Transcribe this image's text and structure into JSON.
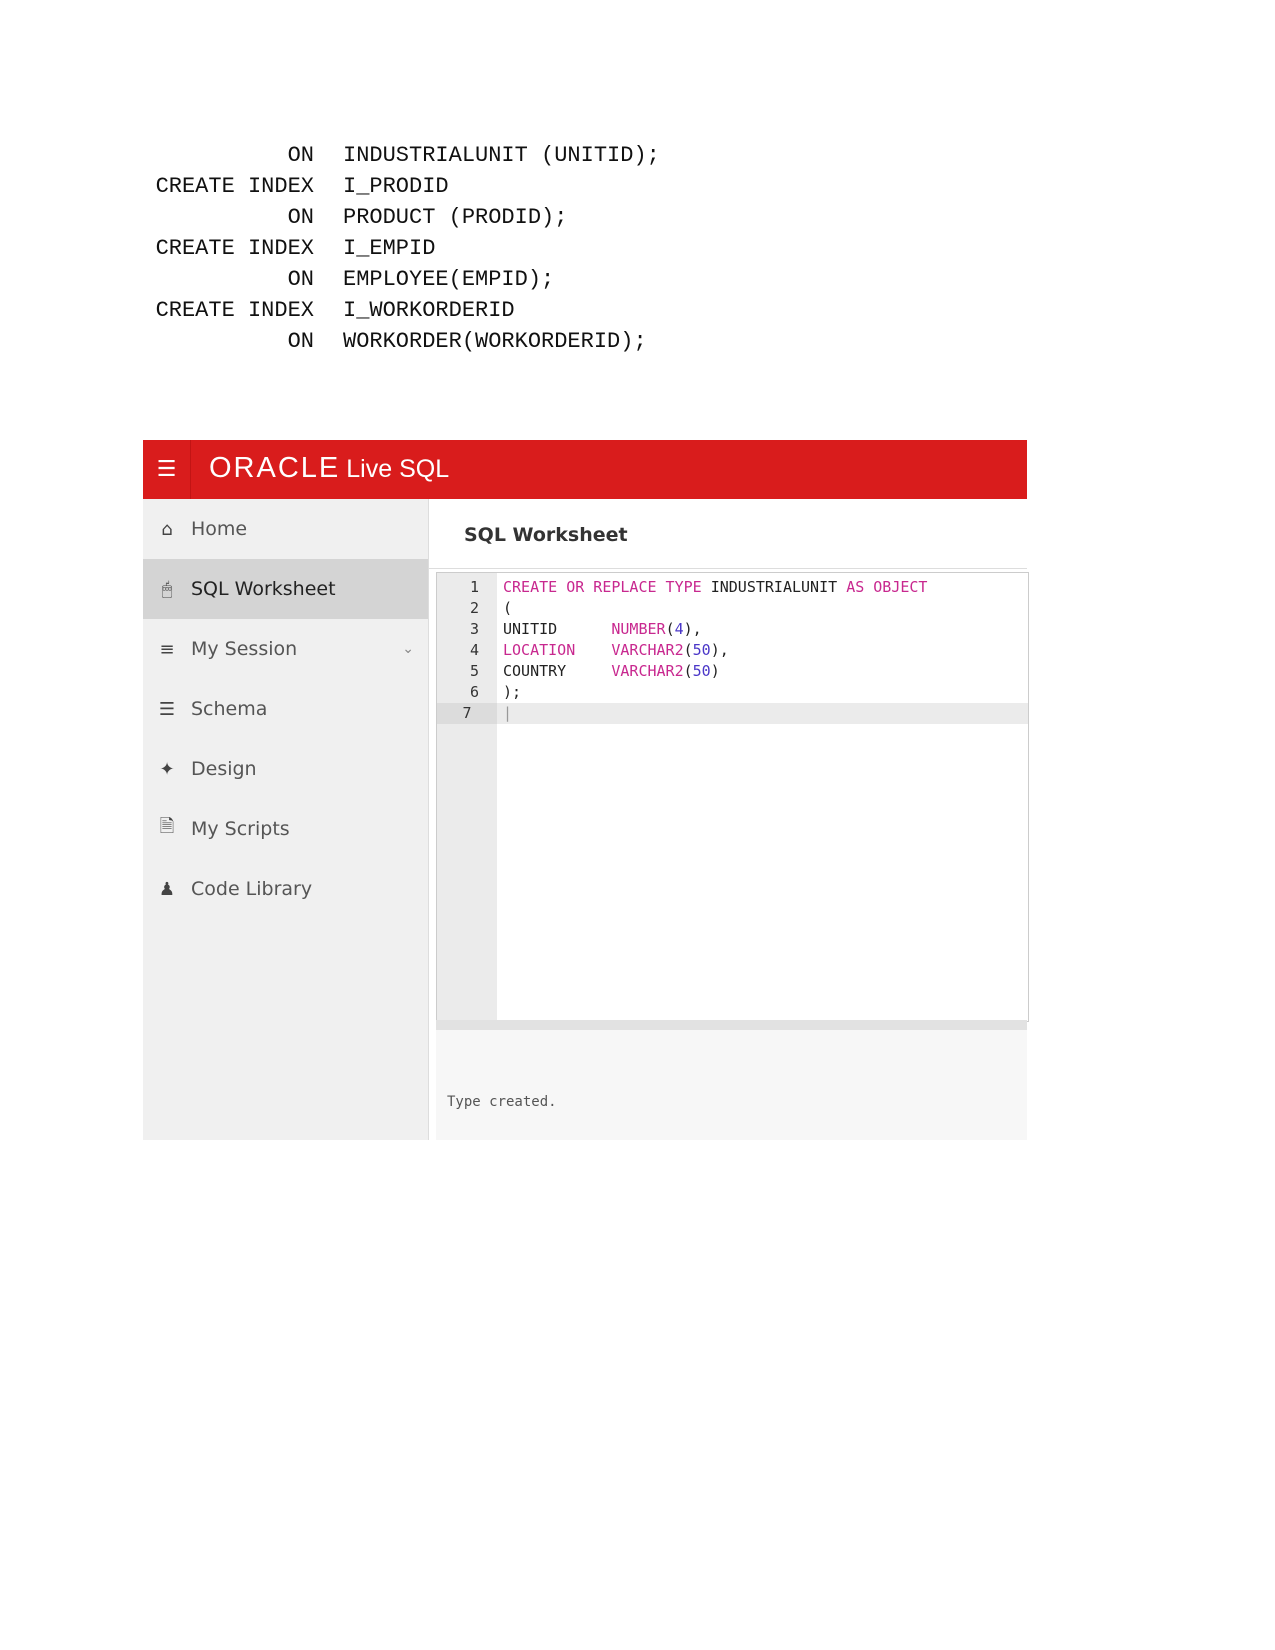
{
  "document_code": [
    [
      "ON",
      "INDUSTRIALUNIT (UNITID);"
    ],
    [
      "CREATE INDEX",
      "I_PRODID"
    ],
    [
      "ON",
      "PRODUCT (PRODID);"
    ],
    [
      "CREATE INDEX",
      "I_EMPID"
    ],
    [
      "ON",
      "EMPLOYEE(EMPID);"
    ],
    [
      "CREATE INDEX",
      "I_WORKORDERID"
    ],
    [
      "ON",
      "WORKORDER(WORKORDERID);"
    ]
  ],
  "app": {
    "brand": "ORACLE",
    "product": "Live SQL",
    "accent": "#d91c1c"
  },
  "sidebar": {
    "items": [
      {
        "label": "Home",
        "icon": "home-icon"
      },
      {
        "label": "SQL Worksheet",
        "icon": "monitor-icon",
        "active": true
      },
      {
        "label": "My Session",
        "icon": "list-icon"
      },
      {
        "label": "Schema",
        "icon": "database-icon"
      },
      {
        "label": "Design",
        "icon": "wand-icon"
      },
      {
        "label": "My Scripts",
        "icon": "document-icon"
      },
      {
        "label": "Code Library",
        "icon": "users-icon"
      }
    ]
  },
  "main": {
    "title": "SQL Worksheet",
    "editor_lines": [
      {
        "n": "1",
        "html": "<span class=\"kw\">CREATE OR REPLACE TYPE</span> INDUSTRIALUNIT <span class=\"kw\">AS OBJECT</span>"
      },
      {
        "n": "2",
        "html": "("
      },
      {
        "n": "3",
        "html": "UNITID      <span class=\"kw\">NUMBER</span>(<span class=\"num\">4</span>),"
      },
      {
        "n": "4",
        "html": "<span class=\"kw\">LOCATION</span>    <span class=\"kw\">VARCHAR2</span>(<span class=\"num\">50</span>),"
      },
      {
        "n": "5",
        "html": "COUNTRY     <span class=\"kw\">VARCHAR2</span>(<span class=\"num\">50</span>)"
      },
      {
        "n": "6",
        "html": ");"
      },
      {
        "n": "7",
        "html": "|"
      }
    ],
    "output": "Type created."
  }
}
